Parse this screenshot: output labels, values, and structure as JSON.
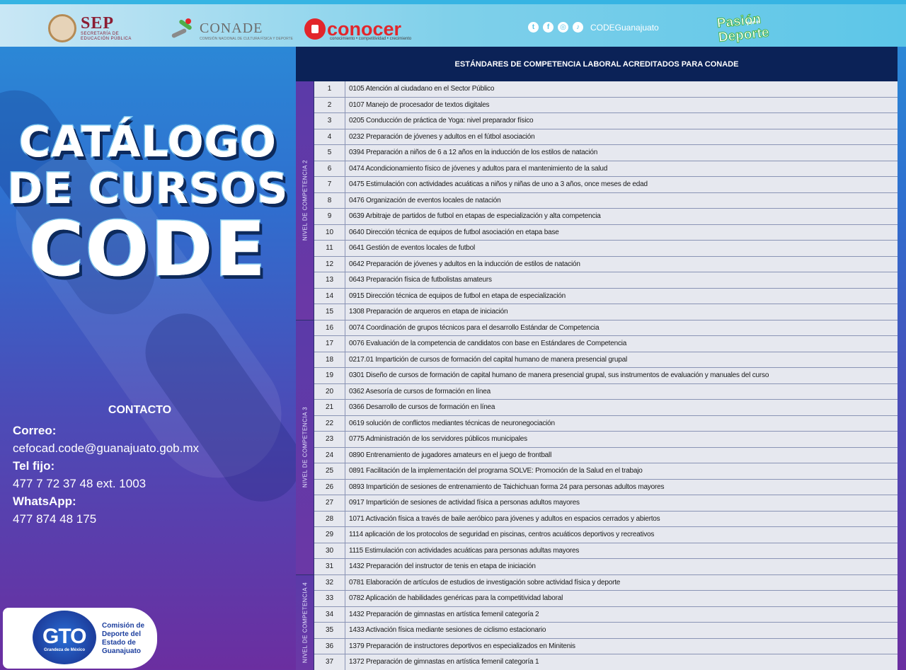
{
  "header": {
    "sep": {
      "name": "SEP",
      "sub1": "SECRETARÍA DE",
      "sub2": "EDUCACIÓN PÚBLICA"
    },
    "conade": {
      "name": "CONADE",
      "sub": "COMISIÓN NACIONAL DE CULTURA FÍSICA Y DEPORTE"
    },
    "conocer": {
      "name": "conocer",
      "sub": "conocimiento • competitividad • crecimiento"
    },
    "social_handle": "CODEGuanajuato",
    "social_icons": [
      "twitter-icon",
      "facebook-icon",
      "instagram-icon",
      "tiktok-icon"
    ],
    "pasion": {
      "w1": "Pasión",
      "w2": "por el",
      "w3": "Deporte"
    }
  },
  "title": {
    "line1": "CATÁLOGO",
    "line2": "DE CURSOS",
    "line3": "CODE"
  },
  "contact": {
    "heading": "CONTACTO",
    "email_label": "Correo:",
    "email": "cefocad.code@guanajuato.gob.mx",
    "phone_label": "Tel fijo:",
    "phone": "477 7 72 37 48 ext. 1003",
    "whatsapp_label": "WhatsApp:",
    "whatsapp": "477 874 48 175"
  },
  "gto": {
    "logo": "GTO",
    "tagline": "Grandeza de México",
    "name": "Comisión de Deporte del Estado de Guanajuato"
  },
  "table": {
    "heading": "ESTÁNDARES DE COMPETENCIA LABORAL ACREDITADOS PARA CONADE",
    "levels": [
      {
        "label": "NIVEL DE COMPETENCIA 2",
        "rows": 15
      },
      {
        "label": "NIVEL DE COMPETENCIA 3",
        "rows": 16
      },
      {
        "label": "NIVEL DE COMPETENCIA 4",
        "rows": 6
      }
    ],
    "rows": [
      {
        "n": "1",
        "t": "0105 Atención al ciudadano  en el  Sector Público"
      },
      {
        "n": "2",
        "t": "0107  Manejo de procesador de textos digitales"
      },
      {
        "n": "3",
        "t": "0205  Conducción de  práctica de Yoga: nivel preparador físico"
      },
      {
        "n": "4",
        "t": "0232 Preparación de jóvenes y adultos  en el fútbol asociación"
      },
      {
        "n": "5",
        "t": "0394 Preparación a niños de 6 a 12 años en la inducción de los estilos de natación"
      },
      {
        "n": "6",
        "t": "0474 Acondicionamiento  físico de jóvenes y adultos para el mantenimiento de la salud"
      },
      {
        "n": "7",
        "t": "0475 Estimulación con actividades acuáticas a niños y niñas de uno a 3 años, once meses de edad"
      },
      {
        "n": "8",
        "t": "0476 Organización de eventos locales de natación"
      },
      {
        "n": "9",
        "t": "0639 Arbitraje de partidos de futbol en etapas de especialización y alta competencia"
      },
      {
        "n": "10",
        "t": "0640 Dirección técnica de equipos de futbol asociación en etapa base"
      },
      {
        "n": "11",
        "t": "0641 Gestión de eventos locales de futbol"
      },
      {
        "n": "12",
        "t": "0642 Preparación de jóvenes y adultos  en la inducción de estilos de natación"
      },
      {
        "n": "13",
        "t": "0643 Preparación física de futbolistas amateurs"
      },
      {
        "n": "14",
        "t": "0915 Dirección técnica de equipos de futbol en etapa de especialización"
      },
      {
        "n": "15",
        "t": "1308 Preparación de arqueros en etapa de iniciación"
      },
      {
        "n": "16",
        "t": "0074 Coordinación de grupos técnicos para el desarrollo Estándar de Competencia"
      },
      {
        "n": "17",
        "t": "0076 Evaluación de la competencia de candidatos con base en Estándares de Competencia"
      },
      {
        "n": "18",
        "t": "0217.01 Impartición de cursos de formación del capital humano de manera presencial grupal"
      },
      {
        "n": "19",
        "t": "0301 Diseño de cursos de formación de capital humano de manera presencial grupal, sus instrumentos de evaluación y manuales del curso"
      },
      {
        "n": "20",
        "t": "0362 Asesoría de cursos de formación en línea"
      },
      {
        "n": "21",
        "t": "0366 Desarrollo de cursos de formación en línea"
      },
      {
        "n": "22",
        "t": "0619 solución de conflictos mediantes técnicas de neuronegociación"
      },
      {
        "n": "23",
        "t": "0775 Administración de los servidores públicos municipales"
      },
      {
        "n": "24",
        "t": "0890 Entrenamiento de jugadores amateurs en el juego de frontball"
      },
      {
        "n": "25",
        "t": "0891 Facilitación de la implementación del programa SOLVE: Promoción de la Salud en el trabajo"
      },
      {
        "n": "26",
        "t": "0893 Impartición de sesiones de entrenamiento de Taichichuan forma 24 para personas adultos mayores"
      },
      {
        "n": "27",
        "t": "0917 Impartición de sesiones de actividad física a personas  adultos mayores"
      },
      {
        "n": "28",
        "t": "1071 Activación física a través de baile aeróbico para jóvenes y adultos en espacios cerrados y abiertos"
      },
      {
        "n": "29",
        "t": "1114 aplicación de los protocolos de seguridad en piscinas, centros acuáticos deportivos y recreativos"
      },
      {
        "n": "30",
        "t": "1115 Estimulación con actividades acuáticas para personas adultas mayores"
      },
      {
        "n": "31",
        "t": "1432 Preparación del instructor de tenis en etapa de iniciación"
      },
      {
        "n": "32",
        "t": "0781 Elaboración de artículos de estudios de investigación sobre actividad física y deporte"
      },
      {
        "n": "33",
        "t": "0782 Aplicación de habilidades genéricas  para la competitividad laboral"
      },
      {
        "n": "34",
        "t": "1432 Preparación de gimnastas en artística femenil categoría 2"
      },
      {
        "n": "35",
        "t": "1433 Activación física mediante sesiones de ciclismo estacionario"
      },
      {
        "n": "36",
        "t": "1379  Preparación de instructores deportivos en especializados en Minitenis"
      },
      {
        "n": "37",
        "t": "1372 Preparación de gimnastas en artística femenil categoría 1"
      }
    ]
  }
}
